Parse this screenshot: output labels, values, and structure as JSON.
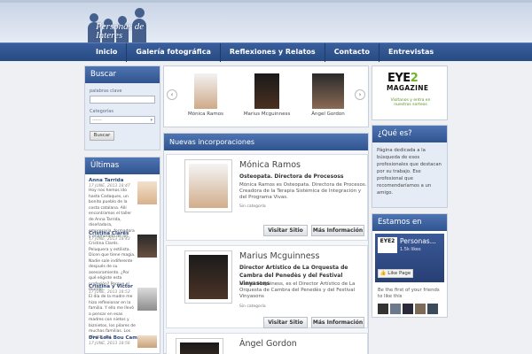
{
  "header": {
    "logo_text": "Personas de Interes"
  },
  "nav": {
    "items": [
      "Inicio",
      "Galería fotográfica",
      "Reflexiones y Relatos",
      "Contacto",
      "Entrevistas"
    ]
  },
  "search": {
    "title": "Buscar",
    "keywords_label": "palabras clave",
    "categories_label": "Categorías",
    "select_value": "------",
    "button": "Buscar"
  },
  "interviews": {
    "title": "Últimas Entrevistas",
    "items": [
      {
        "name": "Anna Tarrida",
        "date": "17 JUNE, 2013 18:47",
        "excerpt": "Hoy nos hemos ido hasta Cadaques, un bonito pueblo de la costa catalana. Allí encontramos el taller de Anna Tarrida, diseñadora, empresaria, formadora y enamorada de los"
      },
      {
        "name": "Cristina Clarés",
        "date": "17 JUNE, 2013 18:43",
        "excerpt": "Cristina Clarés. Peluquera y estilista. Dicen que tiene magia. Nadie sale indiferente después de su asesoramiento. ¿Por qué eligiste esta profesión? Porque el mundo"
      },
      {
        "name": "Cristina y Victor",
        "date": "17 JUNE, 2013 18:52",
        "excerpt": "El día de la madre me hizo reflexionar en la familia. Y ello me llevó a pensar en esas madres con nietos y biznietos, los pilares de muchas familias. Los efectos del"
      },
      {
        "name": "Dra Lola Bou Camps",
        "date": "17 JUNE, 2013 18:56",
        "excerpt": ""
      }
    ]
  },
  "carousel": {
    "items": [
      {
        "name": "Mónica Ramos"
      },
      {
        "name": "Marius Mcguinness"
      },
      {
        "name": "Àngel Gordon"
      }
    ]
  },
  "main": {
    "title": "Nuevas incorporaciones",
    "entries": [
      {
        "name": "Mónica Ramos",
        "role": "Osteopata. Directora de Procesoss",
        "desc": "Mónica Ramos es Osteopata. Directora de Procesos. Creadora de la Terapia Sistémica de Integración y del Programa Vivas.",
        "category": "Sin categoría",
        "btn_visit": "Visitar Sitio",
        "btn_more": "Más Información"
      },
      {
        "name": "Marius Mcguinness",
        "role": "Director Artístico de La Orquesta de Cambra del Penedès y del Festival Vinyasons",
        "desc": "Marius Mcguiness, es el Director Artístico de La Orquesta de Cambra del Penedès y del Festival Vinyasons",
        "category": "Sin categoría",
        "btn_visit": "Visitar Sitio",
        "btn_more": "Más Información"
      },
      {
        "name": "Àngel Gordon",
        "role": "",
        "desc": "",
        "category": "",
        "btn_visit": "",
        "btn_more": ""
      }
    ]
  },
  "ad": {
    "eye": "EYE",
    "two": "2",
    "magazine": "MAGAZINE",
    "tagline": "Visítanos y entra en nuestros sorteos"
  },
  "about": {
    "title": "¿Qué es?",
    "text": "Página dedicada a la búsqueda de esos profesionales que destacan por su trabajo. Ese profesional que recomendaríamos a un amigo."
  },
  "facebook": {
    "title": "Estamos en Facebook",
    "logo": "EYE2",
    "page_name": "Personas...",
    "likes": "1.5k likes",
    "like_button": "Like Page",
    "friends_text": "Be the first of your friends to like this"
  },
  "colors": {
    "nav": "#274a82",
    "box_title": "#3a5f9c",
    "accent_green": "#6fb22b"
  }
}
